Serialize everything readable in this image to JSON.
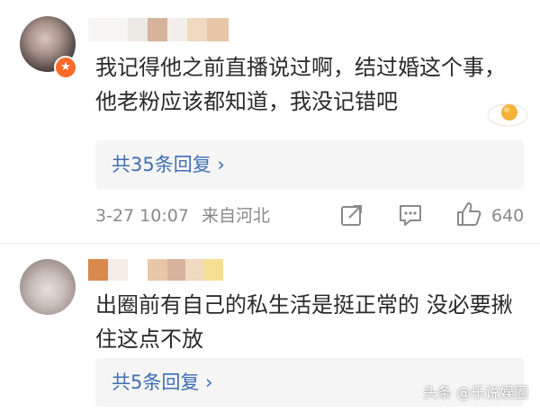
{
  "comments": [
    {
      "text": "我记得他之前直播说过啊，结过婚这个事，他老粉应该都知道，我没记错吧",
      "badge_glyph": "★",
      "reply_label": "共35条回复 ›",
      "date": "3-27 10:07",
      "location": "来自河北",
      "likes": "640"
    },
    {
      "text": "出圈前有自己的私生活是挺正常的 没必要揪住这点不放",
      "reply_label": "共5条回复 ›"
    }
  ],
  "watermark": "头条 @乐说娱圈",
  "colors": {
    "reply_link": "#3f6fb4",
    "meta": "#8a8a8a",
    "badge": "#ff6a2a",
    "reply_bg": "#f5f5f5"
  },
  "icons": [
    "share-icon",
    "comment-icon",
    "like-icon",
    "fried-egg-sticker"
  ]
}
